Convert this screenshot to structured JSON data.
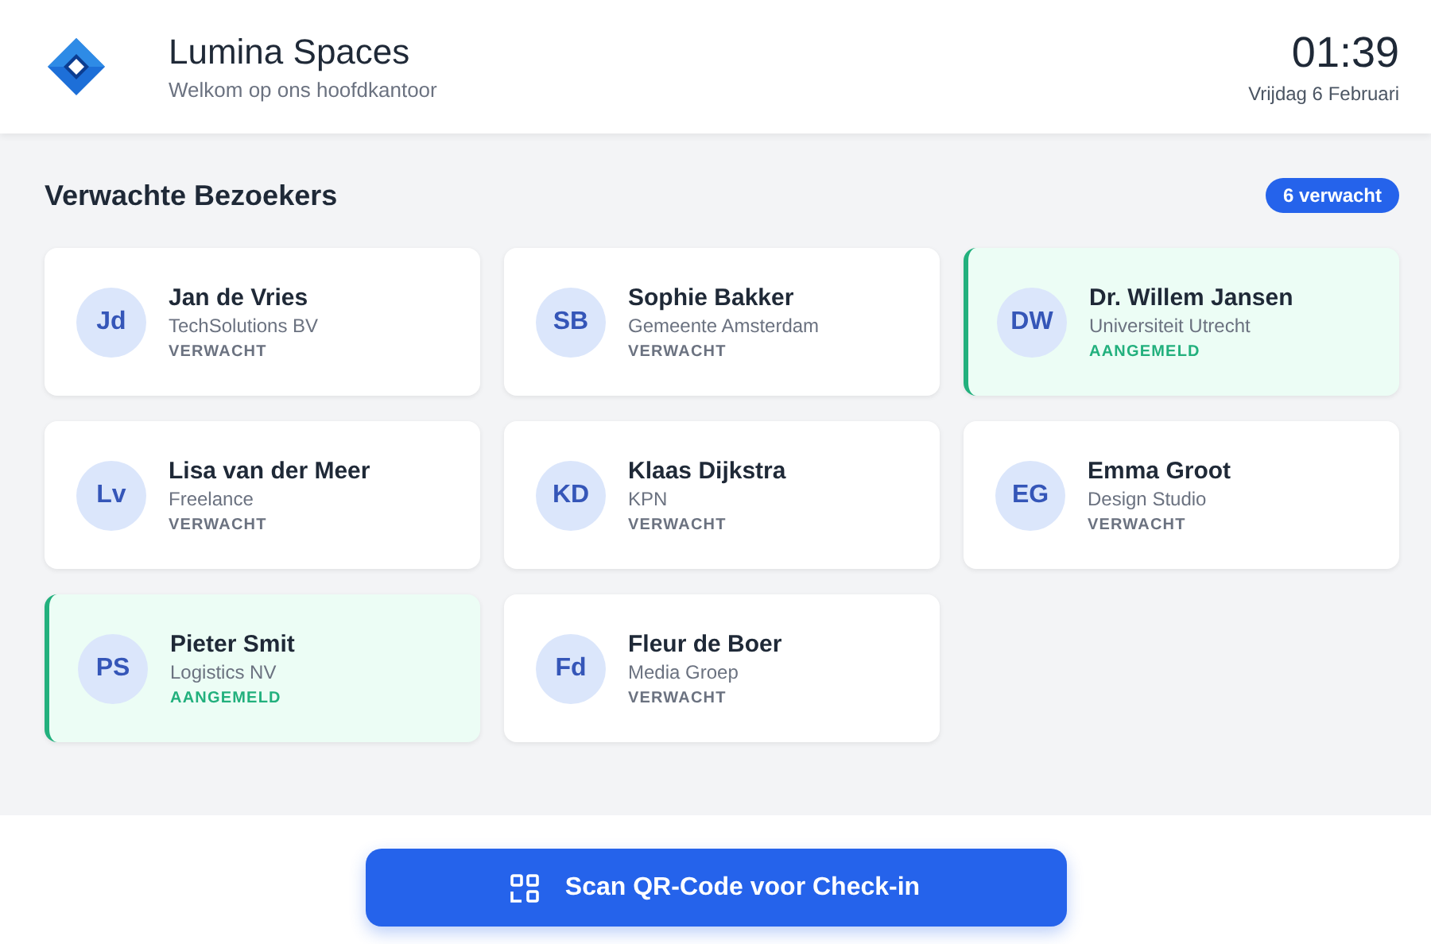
{
  "header": {
    "title": "Lumina Spaces",
    "subtitle": "Welkom op ons hoofdkantoor",
    "time": "01:39",
    "date": "Vrijdag 6 Februari"
  },
  "section": {
    "title": "Verwachte Bezoekers",
    "badge": "6 verwacht"
  },
  "visitors": [
    {
      "initials": "Jd",
      "name": "Jan de Vries",
      "company": "TechSolutions BV",
      "status": "VERWACHT",
      "checked_in": false
    },
    {
      "initials": "SB",
      "name": "Sophie Bakker",
      "company": "Gemeente Amsterdam",
      "status": "VERWACHT",
      "checked_in": false
    },
    {
      "initials": "DW",
      "name": "Dr. Willem Jansen",
      "company": "Universiteit Utrecht",
      "status": "AANGEMELD",
      "checked_in": true
    },
    {
      "initials": "Lv",
      "name": "Lisa van der Meer",
      "company": "Freelance",
      "status": "VERWACHT",
      "checked_in": false
    },
    {
      "initials": "KD",
      "name": "Klaas Dijkstra",
      "company": "KPN",
      "status": "VERWACHT",
      "checked_in": false
    },
    {
      "initials": "EG",
      "name": "Emma Groot",
      "company": "Design Studio",
      "status": "VERWACHT",
      "checked_in": false
    },
    {
      "initials": "PS",
      "name": "Pieter Smit",
      "company": "Logistics NV",
      "status": "AANGEMELD",
      "checked_in": true
    },
    {
      "initials": "Fd",
      "name": "Fleur de Boer",
      "company": "Media Groep",
      "status": "VERWACHT",
      "checked_in": false
    }
  ],
  "scan_button": {
    "label": "Scan QR-Code voor Check-in"
  }
}
